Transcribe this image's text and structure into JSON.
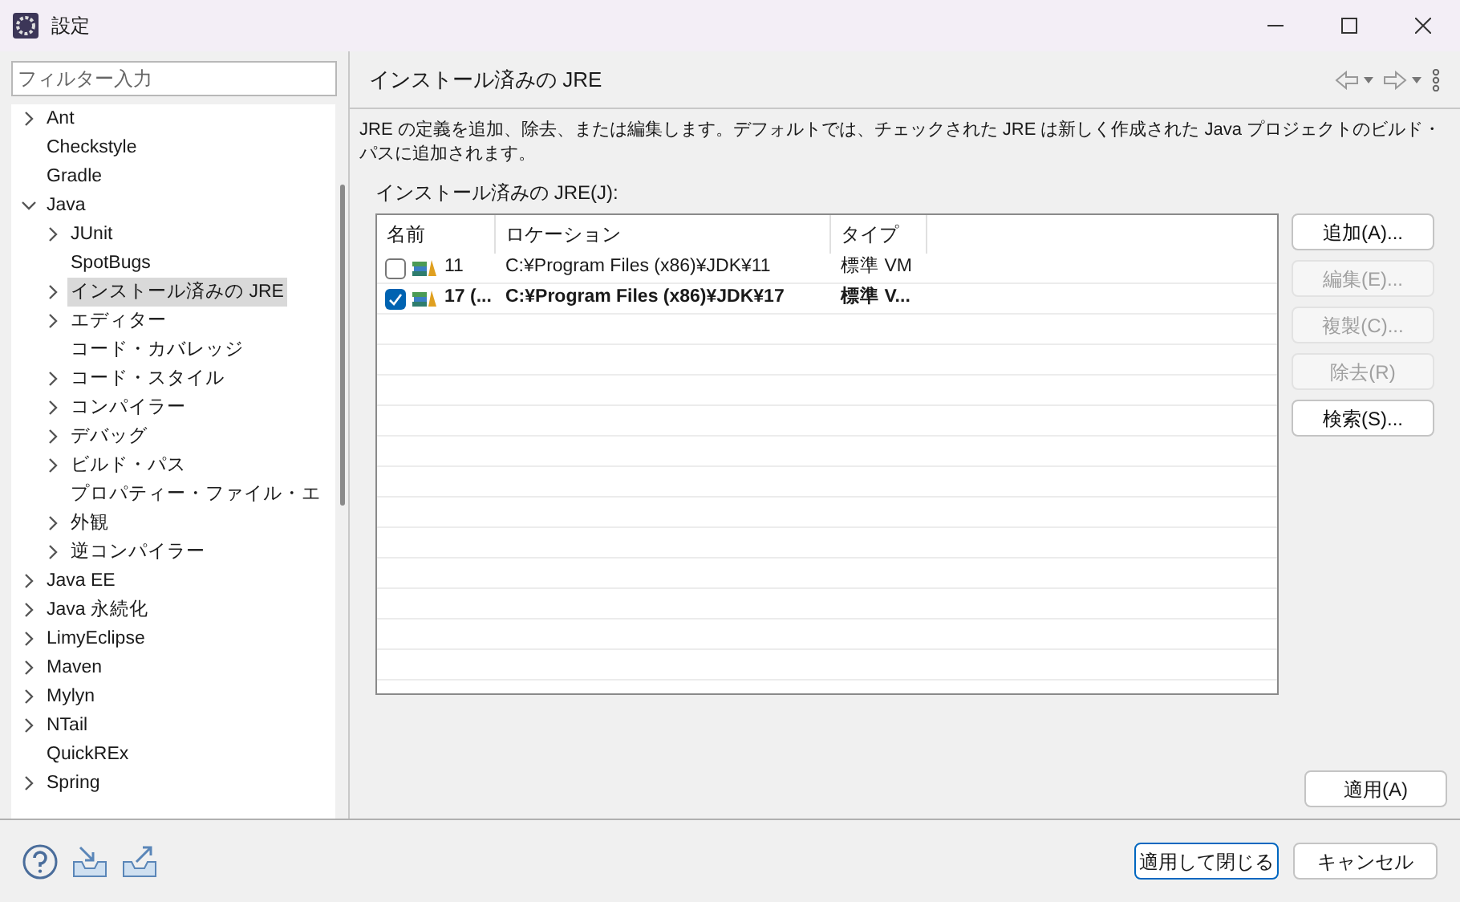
{
  "window": {
    "title": "設定"
  },
  "filter": {
    "placeholder": "フィルター入力"
  },
  "tree": [
    {
      "label": "Ant",
      "kind": "folder",
      "expanded": false,
      "selected": false
    },
    {
      "label": "Checkstyle",
      "kind": "leaf",
      "selected": false
    },
    {
      "label": "Gradle",
      "kind": "leaf",
      "selected": false
    },
    {
      "label": "Java",
      "kind": "folder",
      "expanded": true,
      "selected": false,
      "children": [
        {
          "label": "JUnit",
          "kind": "folder",
          "expanded": false,
          "selected": false
        },
        {
          "label": "SpotBugs",
          "kind": "leaf",
          "selected": false
        },
        {
          "label": "インストール済みの JRE",
          "kind": "folder",
          "expanded": false,
          "selected": true
        },
        {
          "label": "エディター",
          "kind": "folder",
          "expanded": false,
          "selected": false
        },
        {
          "label": "コード・カバレッジ",
          "kind": "leaf",
          "selected": false
        },
        {
          "label": "コード・スタイル",
          "kind": "folder",
          "expanded": false,
          "selected": false
        },
        {
          "label": "コンパイラー",
          "kind": "folder",
          "expanded": false,
          "selected": false
        },
        {
          "label": "デバッグ",
          "kind": "folder",
          "expanded": false,
          "selected": false
        },
        {
          "label": "ビルド・パス",
          "kind": "folder",
          "expanded": false,
          "selected": false
        },
        {
          "label": "プロパティー・ファイル・エ",
          "kind": "leaf",
          "selected": false
        },
        {
          "label": "外観",
          "kind": "folder",
          "expanded": false,
          "selected": false
        },
        {
          "label": "逆コンパイラー",
          "kind": "folder",
          "expanded": false,
          "selected": false
        }
      ]
    },
    {
      "label": "Java EE",
      "kind": "folder",
      "expanded": false,
      "selected": false
    },
    {
      "label": "Java 永続化",
      "kind": "folder",
      "expanded": false,
      "selected": false
    },
    {
      "label": "LimyEclipse",
      "kind": "folder",
      "expanded": false,
      "selected": false
    },
    {
      "label": "Maven",
      "kind": "folder",
      "expanded": false,
      "selected": false
    },
    {
      "label": "Mylyn",
      "kind": "folder",
      "expanded": false,
      "selected": false
    },
    {
      "label": "NTail",
      "kind": "folder",
      "expanded": false,
      "selected": false
    },
    {
      "label": "QuickREx",
      "kind": "leaf",
      "selected": false
    },
    {
      "label": "Spring",
      "kind": "folder",
      "expanded": false,
      "selected": false
    }
  ],
  "page": {
    "title": "インストール済みの JRE",
    "description": "JRE の定義を追加、除去、または編集します。デフォルトでは、チェックされた JRE は新しく作成された Java プロジェクトのビルド・パスに追加されます。",
    "table_label": "インストール済みの JRE(J):"
  },
  "table": {
    "columns": [
      "名前",
      "ロケーション",
      "タイプ"
    ],
    "rows": [
      {
        "checked": false,
        "name": "11",
        "location": "C:¥Program Files (x86)¥JDK¥11",
        "type": "標準 VM"
      },
      {
        "checked": true,
        "name": "17 (...",
        "location": "C:¥Program Files (x86)¥JDK¥17",
        "type": "標準 V..."
      }
    ]
  },
  "side_buttons": [
    {
      "label": "追加(A)...",
      "disabled": false
    },
    {
      "label": "編集(E)...",
      "disabled": true
    },
    {
      "label": "複製(C)...",
      "disabled": true
    },
    {
      "label": "除去(R)",
      "disabled": true
    },
    {
      "label": "検索(S)...",
      "disabled": false
    }
  ],
  "apply_button": "適用(A)",
  "footer_buttons": [
    {
      "label": "適用して閉じる",
      "selected": true
    },
    {
      "label": "キャンセル",
      "selected": false
    }
  ]
}
